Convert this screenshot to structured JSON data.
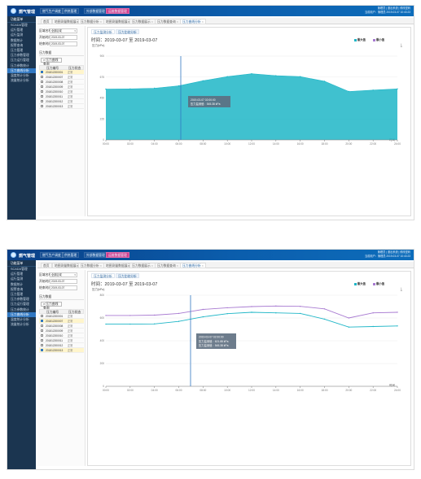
{
  "app": {
    "title": "燃气管理",
    "nav": [
      "燃气生产调度",
      "供热管理",
      "外部数据管理",
      "运维数据管理"
    ],
    "active_nav_index": 3,
    "user_lines": [
      "管理员 | 退出系统 | 修改密码",
      "当前用户：管理员 2019-03-07 10:43:23"
    ]
  },
  "sidebar": {
    "title": "功能菜单",
    "items": [
      "SCADA管理",
      "运行管理",
      "运行监测",
      "数据统计",
      "报警查询",
      "压力管理",
      "压力参数管理",
      "压力运行管理",
      "压力参数统计",
      "压力曲线分析",
      "温度统计分析",
      "流量统计分析"
    ],
    "active_index": 9
  },
  "tabs": [
    {
      "label": "首页"
    },
    {
      "label": "地图测量数据展示"
    },
    {
      "label": "压力数据分析"
    },
    {
      "label": "地图测量数据展示"
    },
    {
      "label": "压力数据展示"
    },
    {
      "label": "压力数据查询"
    },
    {
      "label": "压力曲线分析"
    }
  ],
  "active_tab_index": 6,
  "filters": {
    "area_label": "区域名称",
    "area_value": "全部区域",
    "start_label": "开始时间",
    "start_value": "2019-03-07",
    "end_label": "结束时间",
    "end_value": "2019-03-07",
    "device_group_label": "压力数据",
    "query_label": "压力曲线查询",
    "table_headers": [
      "压力编号",
      "压力状态"
    ]
  },
  "devices_1": [
    {
      "code": "201812200001",
      "status": "正常"
    },
    {
      "code": "201812200007",
      "status": "正常"
    },
    {
      "code": "201812200008",
      "status": "正常"
    },
    {
      "code": "201812200009",
      "status": "正常"
    },
    {
      "code": "201812200010",
      "status": "正常"
    },
    {
      "code": "201812200011",
      "status": "正常"
    },
    {
      "code": "201812200012",
      "status": "正常"
    },
    {
      "code": "201812200013",
      "status": "正常"
    }
  ],
  "devices_2": [
    {
      "code": "201812200001",
      "status": "正常"
    },
    {
      "code": "201812200007",
      "status": "正常"
    },
    {
      "code": "201812200008",
      "status": "正常"
    },
    {
      "code": "201812200009",
      "status": "正常"
    },
    {
      "code": "201812200010",
      "status": "正常"
    },
    {
      "code": "201812200011",
      "status": "正常"
    },
    {
      "code": "201812200012",
      "status": "正常"
    },
    {
      "code": "201812200013",
      "status": "正常"
    }
  ],
  "chart_tabs": [
    "压力监测分析",
    "压力比较分析"
  ],
  "time_label": "时间：2019-03-07 至 2019-03-07",
  "legend": [
    "最大值",
    "最小值"
  ],
  "tooltip1": {
    "title": "2019-03-07 02:00:00",
    "line": "压力监测值：545.38 kPa"
  },
  "tooltip2": {
    "title": "2019-03-07 02:00:00",
    "lines": [
      "压力监测值：621.88 kPa",
      "压力监测值：545.38 kPa"
    ]
  },
  "colors": {
    "series1": "#1fb6c7",
    "series2": "#a87ad1",
    "accent": "#2f77c2",
    "active_nav": "#d13f8f"
  },
  "chart_data": [
    {
      "type": "area",
      "title": "",
      "ylabel": "压力(kPa)",
      "xlabel": "时间",
      "ylim": [
        0,
        900
      ],
      "x": [
        "00:00",
        "02:00",
        "04:00",
        "06:00",
        "08:00",
        "10:00",
        "12:00",
        "14:00",
        "16:00",
        "18:00",
        "20:00",
        "22:00",
        "24:00"
      ],
      "series": [
        {
          "name": "",
          "values": [
            545,
            548,
            555,
            580,
            635,
            680,
            710,
            690,
            680,
            630,
            520,
            535,
            548
          ]
        }
      ]
    },
    {
      "type": "line",
      "title": "",
      "ylabel": "压力(kPa)",
      "xlabel": "时间",
      "ylim": [
        0,
        800
      ],
      "x": [
        "00:00",
        "02:00",
        "04:00",
        "06:00",
        "08:00",
        "10:00",
        "12:00",
        "14:00",
        "16:00",
        "18:00",
        "20:00",
        "22:00",
        "24:00"
      ],
      "series": [
        {
          "name": "",
          "values": [
            546,
            546,
            548,
            570,
            610,
            638,
            650,
            645,
            640,
            590,
            520,
            525,
            530
          ]
        },
        {
          "name": "",
          "values": [
            622,
            622,
            625,
            640,
            675,
            690,
            700,
            705,
            702,
            680,
            600,
            645,
            650
          ]
        }
      ]
    }
  ]
}
